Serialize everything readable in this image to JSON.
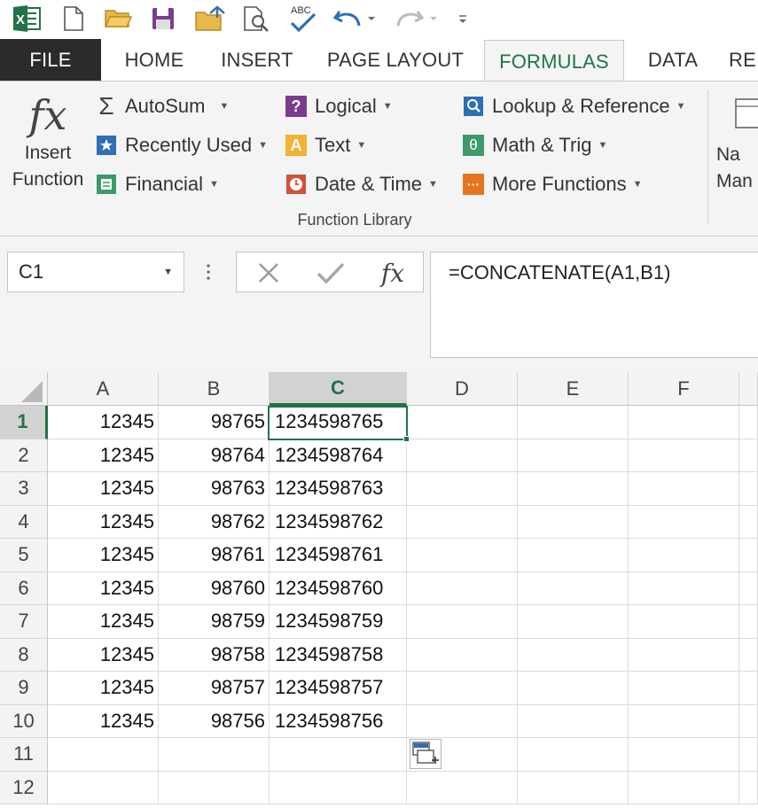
{
  "quick_access": {
    "icons": [
      "excel-logo-icon",
      "new-file-icon",
      "open-folder-icon",
      "save-icon",
      "open-recent-icon",
      "print-preview-icon",
      "spelling-icon",
      "undo-icon",
      "redo-icon",
      "customize-icon"
    ],
    "spelling_abc": "ABC",
    "excel_letter": "X"
  },
  "tabs": {
    "file": "FILE",
    "home": "HOME",
    "insert": "INSERT",
    "page_layout": "PAGE LAYOUT",
    "formulas": "FORMULAS",
    "data": "DATA",
    "review": "RE"
  },
  "ribbon": {
    "insert_function": {
      "symbol": "fx",
      "line1": "Insert",
      "line2": "Function"
    },
    "autosum": "AutoSum",
    "recently_used": "Recently Used",
    "financial": "Financial",
    "logical": "Logical",
    "text": "Text",
    "date_time": "Date & Time",
    "lookup_reference": "Lookup & Reference",
    "math_trig": "Math & Trig",
    "more_functions": "More Functions",
    "group_label": "Function Library",
    "name_manager": {
      "line1": "Na",
      "line2": "Man"
    },
    "sigma": "Σ",
    "icon_glyphs": {
      "logical": "?",
      "text": "A",
      "math": "θ",
      "more": "···"
    }
  },
  "formula_bar": {
    "name_box": "C1",
    "fx": "fx",
    "formula": "=CONCATENATE(A1,B1)"
  },
  "sheet": {
    "columns": [
      "A",
      "B",
      "C",
      "D",
      "E",
      "F"
    ],
    "rows": [
      "1",
      "2",
      "3",
      "4",
      "5",
      "6",
      "7",
      "8",
      "9",
      "10",
      "11",
      "12"
    ],
    "cells": [
      [
        "12345",
        "98765",
        "1234598765"
      ],
      [
        "12345",
        "98764",
        "1234598764"
      ],
      [
        "12345",
        "98763",
        "1234598763"
      ],
      [
        "12345",
        "98762",
        "1234598762"
      ],
      [
        "12345",
        "98761",
        "1234598761"
      ],
      [
        "12345",
        "98760",
        "1234598760"
      ],
      [
        "12345",
        "98759",
        "1234598759"
      ],
      [
        "12345",
        "98758",
        "1234598758"
      ],
      [
        "12345",
        "98757",
        "1234598757"
      ],
      [
        "12345",
        "98756",
        "1234598756"
      ]
    ],
    "selected_cell": "C1"
  },
  "colors": {
    "accent": "#217346",
    "file_tab": "#2b2b2b",
    "ribbon_bg": "#f4f4f4"
  }
}
